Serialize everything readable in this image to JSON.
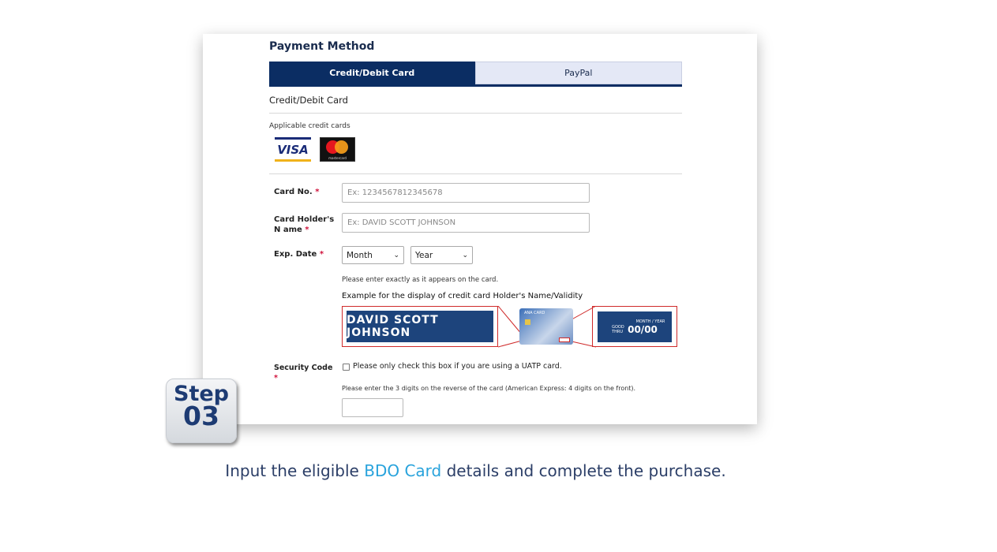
{
  "panel": {
    "title": "Payment Method",
    "tabs": [
      {
        "label": "Credit/Debit Card",
        "active": true
      },
      {
        "label": "PayPal",
        "active": false
      }
    ],
    "section_title": "Credit/Debit Card",
    "applicable_label": "Applicable credit cards",
    "card_logos": {
      "visa": "VISA",
      "mastercard": "mastercard"
    },
    "card_no": {
      "label": "Card No.",
      "required": "*",
      "placeholder": "Ex: 1234567812345678"
    },
    "holder": {
      "label": "Card Holder's N ame",
      "required": "*",
      "placeholder": "Ex: DAVID SCOTT JOHNSON"
    },
    "exp": {
      "label": "Exp. Date",
      "required": "*",
      "month": "Month",
      "year": "Year"
    },
    "note": "Please enter exactly as it appears on the card.",
    "example_title": "Example for the display of credit card Holder's Name/Validity",
    "example_name": "DAVID SCOTT JOHNSON",
    "example_card_brand": "ANA CARD",
    "example_validity": {
      "header": "MONTH / YEAR",
      "good_thru": "GOOD THRU",
      "value": "00/00"
    },
    "security": {
      "label": "Security Code",
      "required": "*",
      "checkbox_label": "Please only check this box if you are using a UATP card.",
      "hint": "Please enter the 3 digits on the reverse of the card (American Express: 4 digits on the front)."
    }
  },
  "step": {
    "word": "Step",
    "number": "03"
  },
  "caption": {
    "before": "Input the eligible ",
    "highlight": "BDO Card",
    "after": " details and complete the purchase."
  },
  "colors": {
    "navy": "#0b2d63",
    "highlight": "#29a3dc",
    "required": "#d0103a"
  }
}
